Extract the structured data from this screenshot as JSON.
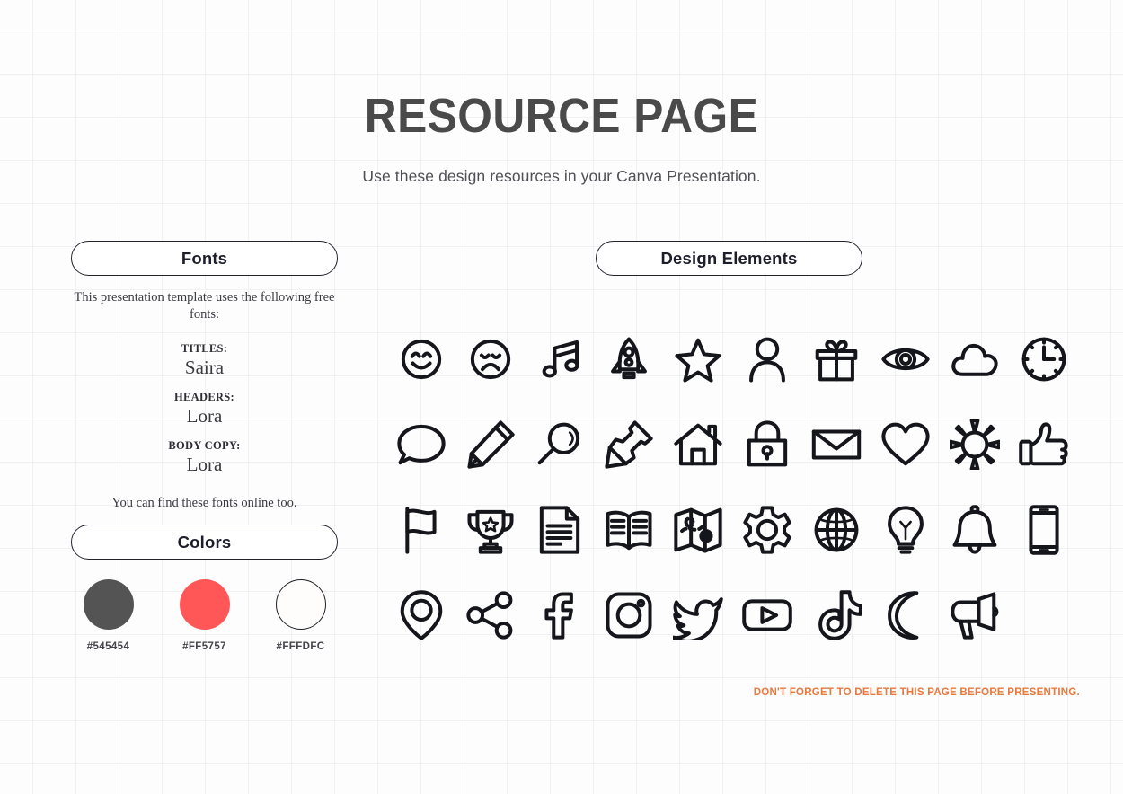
{
  "header": {
    "title": "RESOURCE PAGE",
    "subtitle": "Use these design resources in your Canva Presentation."
  },
  "sections": {
    "fonts_label": "Fonts",
    "colors_label": "Colors",
    "design_elements_label": "Design Elements"
  },
  "fonts": {
    "intro": "This presentation template uses the following free fonts:",
    "entries": [
      {
        "role": "TITLES:",
        "name": "Saira"
      },
      {
        "role": "HEADERS:",
        "name": "Lora"
      },
      {
        "role": "BODY COPY:",
        "name": "Lora"
      }
    ],
    "outro": "You can find these fonts online too."
  },
  "colors": {
    "swatches": [
      {
        "hex": "#545454",
        "fill": "#545454",
        "outlined": false
      },
      {
        "hex": "#FF5757",
        "fill": "#FF5757",
        "outlined": false
      },
      {
        "hex": "#FFFDFC",
        "fill": "#FFFDFC",
        "outlined": true
      }
    ]
  },
  "design_elements": {
    "icons": [
      "smiley-face-icon",
      "sad-face-icon",
      "music-note-icon",
      "rocket-icon",
      "star-icon",
      "person-icon",
      "gift-icon",
      "eye-icon",
      "cloud-icon",
      "clock-icon",
      "speech-bubble-icon",
      "pencil-icon",
      "magnifying-glass-icon",
      "pushpin-icon",
      "house-icon",
      "lock-icon",
      "envelope-icon",
      "heart-icon",
      "sun-icon",
      "thumbs-up-icon",
      "flag-icon",
      "trophy-icon",
      "document-icon",
      "book-icon",
      "map-icon",
      "gear-icon",
      "globe-icon",
      "lightbulb-icon",
      "bell-icon",
      "smartphone-icon",
      "location-pin-icon",
      "share-icon",
      "facebook-icon",
      "instagram-icon",
      "twitter-icon",
      "youtube-icon",
      "tiktok-icon",
      "moon-icon",
      "megaphone-icon"
    ]
  },
  "footer": {
    "warning": "DON'T FORGET TO DELETE THIS PAGE BEFORE PRESENTING.",
    "warning_color": "#E8793F"
  }
}
